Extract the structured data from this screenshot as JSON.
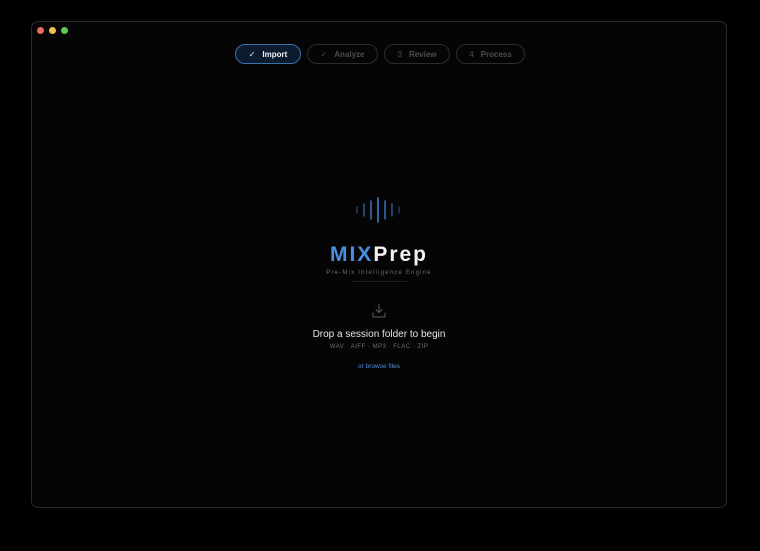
{
  "steps": [
    {
      "mark": "✓",
      "label": "Import",
      "state": "active"
    },
    {
      "mark": "✓",
      "label": "Analyze",
      "state": "done"
    },
    {
      "mark": "3",
      "label": "Review",
      "state": "pending"
    },
    {
      "mark": "4",
      "label": "Process",
      "state": "pending"
    }
  ],
  "brand": {
    "part1": "MIX",
    "part2": "Prep",
    "tagline": "Pre-Mix Intelligence Engine"
  },
  "dropzone": {
    "title": "Drop a session folder to begin",
    "formats": "WAV · AIFF · MP3 · FLAC · ZIP",
    "browse_label": "or browse files"
  },
  "colors": {
    "accent": "#4c8ee0",
    "close": "#ed6a5e",
    "minimize": "#f4be4f",
    "zoom": "#61c554"
  },
  "icons": {
    "logo": "waveform-icon",
    "drop": "download-tray-icon"
  }
}
